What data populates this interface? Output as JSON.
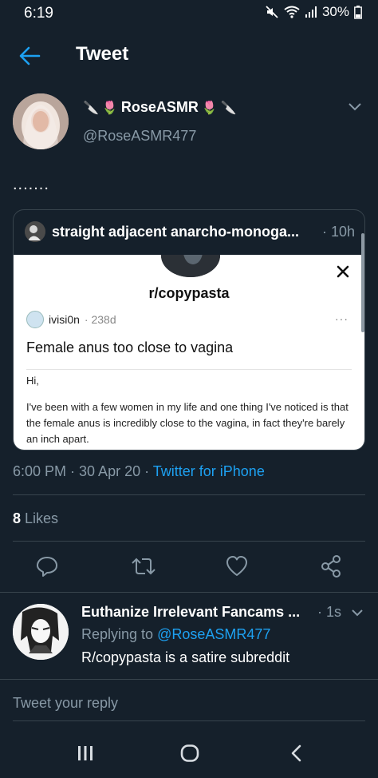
{
  "status_bar": {
    "time": "6:19",
    "battery": "30%"
  },
  "header": {
    "title": "Tweet"
  },
  "tweet": {
    "display_name": "RoseASMR",
    "handle": "@RoseASMR477",
    "text": ".......",
    "timestamp": "6:00 PM · 30 Apr 20 · ",
    "source": "Twitter for iPhone",
    "likes_count": "8",
    "likes_label": " Likes"
  },
  "quote": {
    "author": "straight adjacent anarcho-monoga...",
    "time": "· 10h",
    "image": {
      "subreddit": "r/copypasta",
      "username": "ivisi0n",
      "meta": "· 238d",
      "dots": "···",
      "title": "Female anus too close to vagina",
      "greeting": "Hi,",
      "body": "I've been with a few women in my life and one thing I've noticed is that the female anus is incredibly close to the vagina, in fact they're barely an inch apart."
    }
  },
  "reply": {
    "name": "Euthanize Irrelevant Fancams ...",
    "time": "· 1s",
    "replying_prefix": "Replying to ",
    "replying_mention": "@RoseASMR477",
    "text": "R/copypasta is a satire subreddit"
  },
  "composer": {
    "placeholder": "Tweet your reply"
  },
  "colors": {
    "background": "#15202b",
    "accent": "#1da1f2",
    "muted": "#8899a6",
    "border": "#38444d"
  }
}
